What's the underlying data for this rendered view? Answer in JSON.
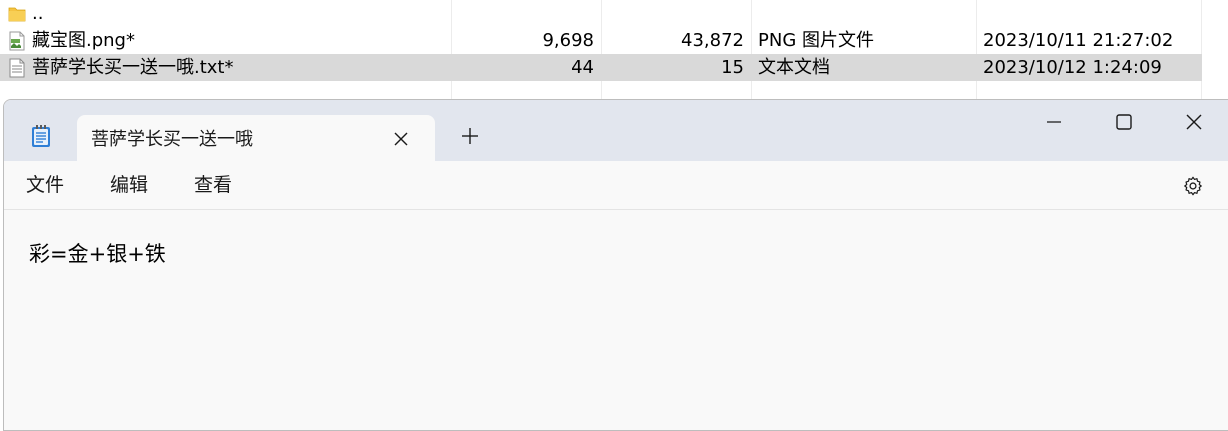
{
  "file_list": {
    "rows": [
      {
        "name": "..",
        "size": "",
        "packed": "",
        "type": "",
        "modified": "",
        "icon": "folder-icon",
        "selected": false
      },
      {
        "name": "藏宝图.png*",
        "size": "9,698",
        "packed": "43,872",
        "type": "PNG 图片文件",
        "modified": "2023/10/11 21:27:02",
        "icon": "image-file-icon",
        "selected": false
      },
      {
        "name": "菩萨学长买一送一哦.txt*",
        "size": "44",
        "packed": "15",
        "type": "文本文档",
        "modified": "2023/10/12 1:24:09",
        "icon": "text-file-icon",
        "selected": true
      }
    ]
  },
  "notepad": {
    "tab_title": "菩萨学长买一送一哦",
    "menu": {
      "file": "文件",
      "edit": "编辑",
      "view": "查看"
    },
    "content": "彩=金+银+铁",
    "icons": {
      "app": "notepad-icon",
      "close_tab": "close-icon",
      "new_tab": "plus-icon",
      "minimize": "minimize-icon",
      "maximize": "maximize-icon",
      "close_window": "close-icon",
      "settings": "gear-icon"
    }
  },
  "colors": {
    "titlebar": "#e2e6ee",
    "selected_row": "#d9d9d9",
    "folder": "#f5c342",
    "notepad_icon": "#2f7fd6"
  }
}
